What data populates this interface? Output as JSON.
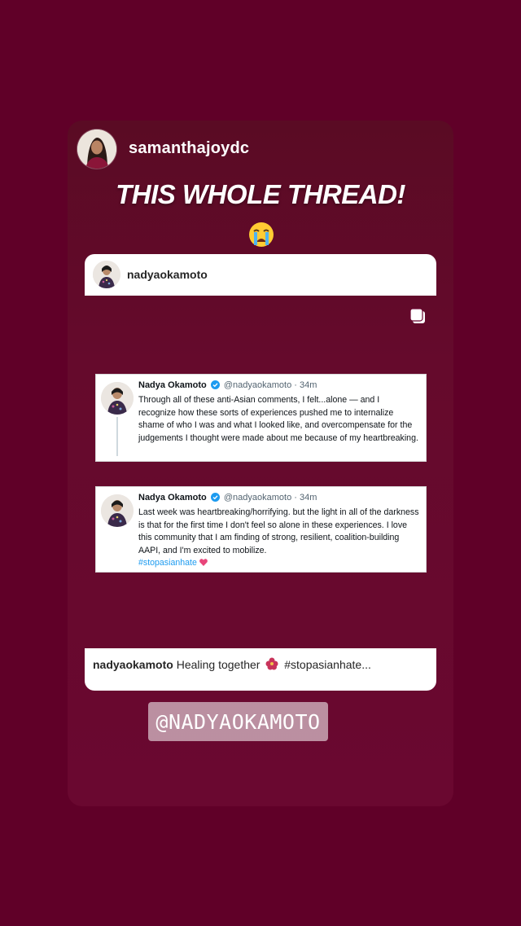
{
  "story": {
    "author": "samanthajoydc",
    "headline": "THIS WHOLE THREAD!",
    "headline_emoji": "crying-face"
  },
  "post": {
    "username": "nadyaokamoto",
    "caption_user": "nadyaokamoto",
    "caption_text": "Healing together",
    "caption_rest": "#stopasianhate..."
  },
  "tweets": [
    {
      "name": "Nadya Okamoto",
      "handle": "@nadyaokamoto",
      "time": "· 34m",
      "text": "Through all of these anti-Asian comments, I felt...alone — and I recognize how these sorts of experiences pushed me to internalize shame of who I was and what I looked like, and overcompensate for the judgements I thought were made about me because of my heartbreaking."
    },
    {
      "name": "Nadya Okamoto",
      "handle": "@nadyaokamoto",
      "time": "· 34m",
      "text": "Last week was heartbreaking/horrifying. but the light in all of the darkness is that for the first time I don't feel so alone in these experiences. I love this community that I am finding of strong, resilient, coalition-building AAPI, and I'm excited to mobilize.",
      "hashtag": "#stopasianhate"
    }
  ],
  "mention_sticker": "@NADYAOKAMOTO",
  "colors": {
    "background": "#600028",
    "card": "#650a2c",
    "link": "#1d9bf0",
    "verified": "#1d9bf0"
  }
}
